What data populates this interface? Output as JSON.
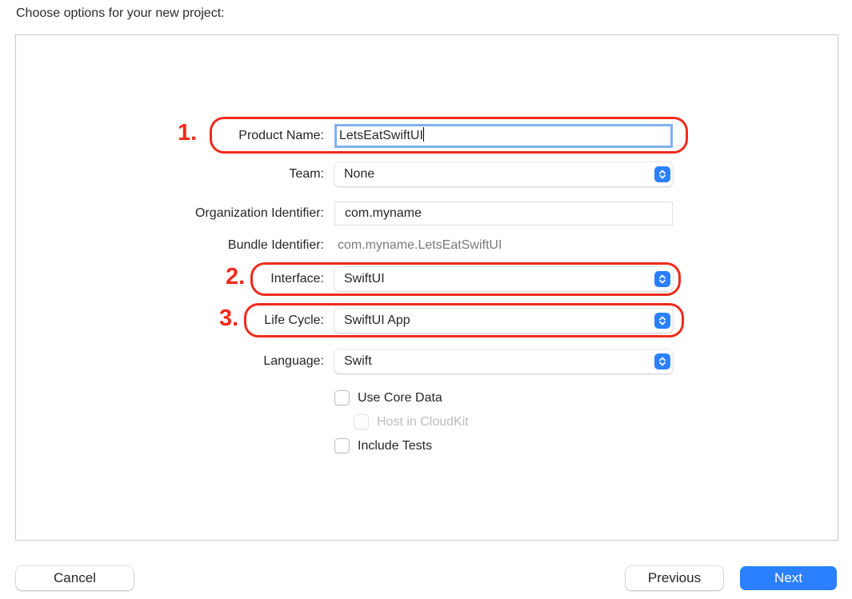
{
  "heading": "Choose options for your new project:",
  "form": {
    "product_name": {
      "label": "Product Name:",
      "value": "LetsEatSwiftUI"
    },
    "team": {
      "label": "Team:",
      "value": "None"
    },
    "organization_identifier": {
      "label": "Organization Identifier:",
      "value": "com.myname"
    },
    "bundle_identifier": {
      "label": "Bundle Identifier:",
      "value": "com.myname.LetsEatSwiftUI"
    },
    "interface": {
      "label": "Interface:",
      "value": "SwiftUI"
    },
    "life_cycle": {
      "label": "Life Cycle:",
      "value": "SwiftUI App"
    },
    "language": {
      "label": "Language:",
      "value": "Swift"
    },
    "checkboxes": [
      {
        "label": "Use Core Data",
        "checked": false,
        "enabled": true
      },
      {
        "label": "Host in CloudKit",
        "checked": false,
        "enabled": false
      },
      {
        "label": "Include Tests",
        "checked": false,
        "enabled": true
      }
    ]
  },
  "annotations": {
    "step1": "1.",
    "step2": "2.",
    "step3": "3.",
    "color": "#f02a1c"
  },
  "buttons": {
    "cancel": "Cancel",
    "previous": "Previous",
    "next": "Next"
  },
  "icons": {
    "popup_stepper": "chevron-up-down-icon"
  },
  "colors": {
    "accent": "#2b80ff",
    "focus_ring": "#7fb2f0",
    "annotation": "#f02a1c"
  }
}
